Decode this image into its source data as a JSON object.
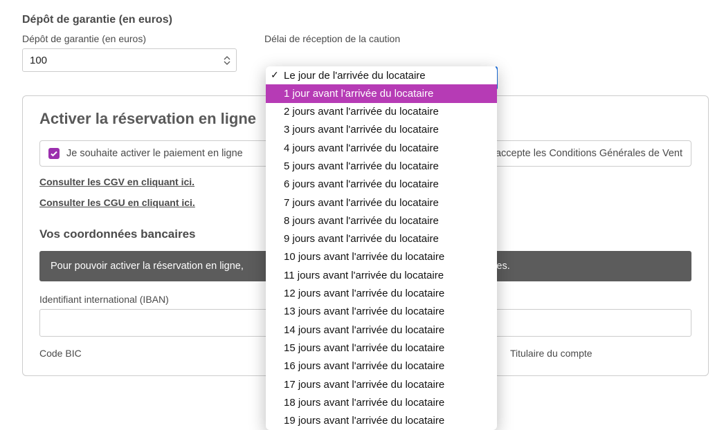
{
  "deposit": {
    "section_title": "Dépôt de garantie (en euros)",
    "label": "Dépôt de garantie (en euros)",
    "value": "100",
    "deadline_label": "Délai de réception de la caution"
  },
  "dropdown": {
    "options": [
      "Le jour de l'arrivée du locataire",
      "1 jour avant l'arrivée du locataire",
      "2 jours avant l'arrivée du locataire",
      "3 jours avant l'arrivée du locataire",
      "4 jours avant l'arrivée du locataire",
      "5 jours avant l'arrivée du locataire",
      "6 jours avant l'arrivée du locataire",
      "7 jours avant l'arrivée du locataire",
      "8 jours avant l'arrivée du locataire",
      "9 jours avant l'arrivée du locataire",
      "10 jours avant l'arrivée du locataire",
      "11 jours avant l'arrivée du locataire",
      "12 jours avant l'arrivée du locataire",
      "13 jours avant l'arrivée du locataire",
      "14 jours avant l'arrivée du locataire",
      "15 jours avant l'arrivée du locataire",
      "16 jours avant l'arrivée du locataire",
      "17 jours avant l'arrivée du locataire",
      "18 jours avant l'arrivée du locataire",
      "19 jours avant l'arrivée du locataire"
    ],
    "selected_index": 0,
    "highlighted_index": 1
  },
  "panel": {
    "title": "Activer la réservation en ligne",
    "consent_prefix": "Je souhaite activer le paiement en ligne ",
    "consent_suffix": "et j'accepte les Conditions Générales de Vent",
    "cgv_link": "Consulter les CGV en cliquant ici.",
    "cgu_link": "Consulter les CGU en cliquant ici.",
    "bank_title": "Vos coordonnées bancaires",
    "info_prefix": "Pour pouvoir activer la réservation en ligne, ",
    "info_suffix": "ancaires.",
    "iban_label": "Identifiant international (IBAN)",
    "iban_value": "",
    "bic_label": "Code BIC",
    "holder_label": "Titulaire du compte"
  }
}
